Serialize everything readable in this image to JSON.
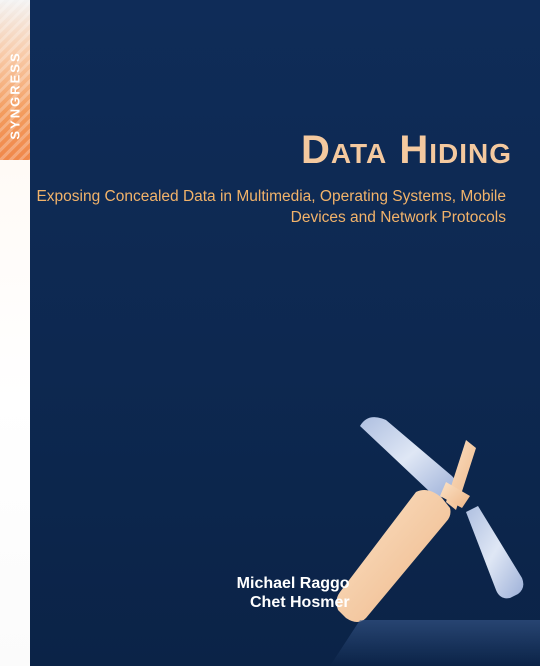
{
  "cover": {
    "publisher": "SYNGRESS",
    "title": "Data Hiding",
    "subtitle": "Exposing Concealed Data in Multimedia, Operating Systems, Mobile Devices and Network Protocols",
    "authors": [
      "Michael Raggo",
      "Chet Hosmer"
    ]
  },
  "colors": {
    "background": "#0e2a55",
    "title": "#f4c99f",
    "subtitle": "#f2b36a",
    "authors": "#ffffff",
    "spine_accent": "#f0874a",
    "emblem_light": "#c9d6ee",
    "emblem_peach": "#f5cfa6"
  }
}
